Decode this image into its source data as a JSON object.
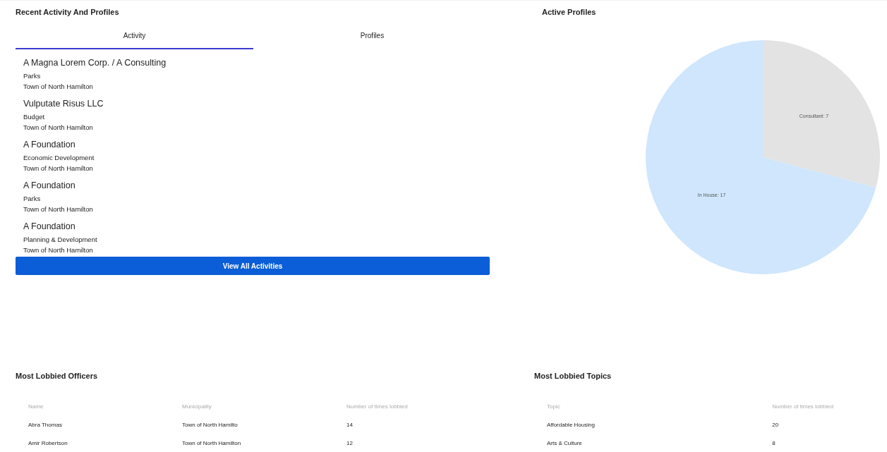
{
  "activity_panel": {
    "title": "Recent Activity And Profiles",
    "tabs": [
      {
        "label": "Activity",
        "selected": true
      },
      {
        "label": "Profiles",
        "selected": false
      }
    ],
    "items": [
      {
        "name": "A Magna Lorem Corp. / A Consulting",
        "topic": "Parks",
        "municipality": "Town of North Hamilton"
      },
      {
        "name": "Vulputate Risus LLC",
        "topic": "Budget",
        "municipality": "Town of North Hamilton"
      },
      {
        "name": "A Foundation",
        "topic": "Economic Development",
        "municipality": "Town of North Hamilton"
      },
      {
        "name": "A Foundation",
        "topic": "Parks",
        "municipality": "Town of North Hamilton"
      },
      {
        "name": "A Foundation",
        "topic": "Planning & Development",
        "municipality": "Town of North Hamilton"
      }
    ],
    "button": "View All Activities"
  },
  "profiles_panel": {
    "title": "Active Profiles",
    "chart_data": {
      "type": "pie",
      "categories": [
        "Consultant",
        "In House"
      ],
      "value_labels": [
        ": 7",
        ": 17"
      ],
      "values": [
        7,
        17
      ]
    }
  },
  "officers": {
    "title": "Most Lobbied Officers",
    "columns": [
      "Name",
      "Municipality",
      "Number of times lobbied"
    ],
    "rows": [
      [
        "Abra Thomas",
        "Town of North Hamilto",
        "14"
      ],
      [
        "Amir Robertson",
        "Town of North Hamilton",
        "12"
      ]
    ]
  },
  "topics": {
    "title": "Most Lobbied Topics",
    "columns": [
      "Topic",
      "Number of times lobbied"
    ],
    "rows": [
      [
        "Affordable Housing",
        "20"
      ],
      [
        "Arts & Culture",
        "8"
      ]
    ]
  }
}
